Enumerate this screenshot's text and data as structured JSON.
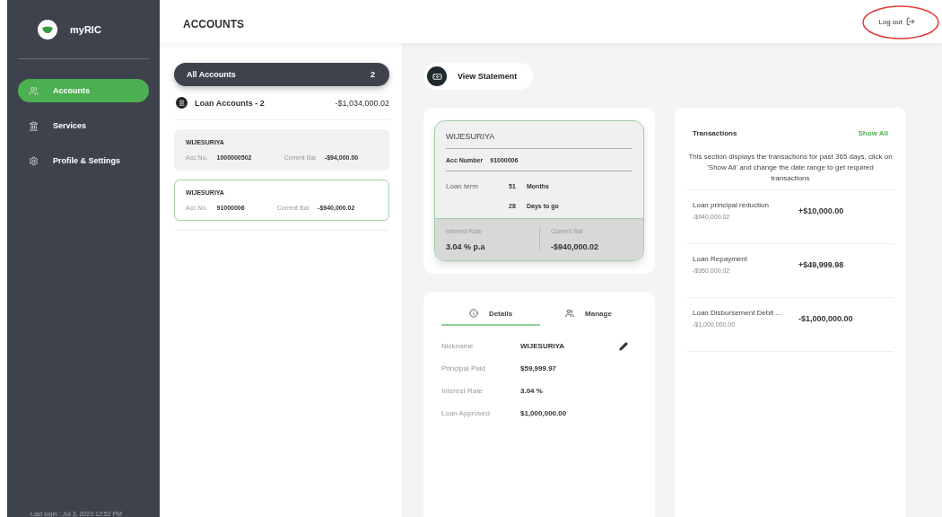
{
  "brand": {
    "name": "myRIC"
  },
  "nav": [
    {
      "label": "Accounts",
      "selected": true
    },
    {
      "label": "Services",
      "selected": false
    },
    {
      "label": "Profile & Settings",
      "selected": false
    }
  ],
  "last_login": "Last login : Jul 3, 2023 12:52 PM",
  "header": {
    "title": "ACCOUNTS",
    "logout": {
      "label": "Log out",
      "circled": true
    }
  },
  "all_accounts": {
    "label": "All Accounts",
    "count": "2"
  },
  "group": {
    "label": "Loan Accounts - 2",
    "total": "-$1,034,000.02"
  },
  "accounts": [
    {
      "name": "WIJESURIYA",
      "acc_label": "Acc No.",
      "acc_no": "1000000502",
      "bal_label": "Current Bal",
      "balance": "-$94,000.00",
      "selected": false
    },
    {
      "name": "WIJESURIYA",
      "acc_label": "Acc No.",
      "acc_no": "91000006",
      "bal_label": "Current Bal",
      "balance": "-$940,000.02",
      "selected": true
    }
  ],
  "view_statement": "View Statement",
  "loan_card": {
    "name": "WIJESURIYA",
    "acc_label": "Acc Number",
    "acc_no": "91000006",
    "term_label": "Loan term",
    "term": [
      {
        "value": "51",
        "unit": "Months"
      },
      {
        "value": "28",
        "unit": "Days to go"
      }
    ],
    "rate_label": "Interest Rate",
    "rate": "3.04 % p.a",
    "bal_label": "Current Bal",
    "balance": "-$940,000.02"
  },
  "detail_tabs": [
    {
      "label": "Details",
      "selected": true
    },
    {
      "label": "Manage",
      "selected": false
    }
  ],
  "details": [
    {
      "label": "Nickname",
      "value": "WIJESURIYA",
      "editable": true
    },
    {
      "label": "Principal Paid",
      "value": "$59,999.97",
      "editable": false
    },
    {
      "label": "Interest Rate",
      "value": "3.04 %",
      "editable": false
    },
    {
      "label": "Loan Approved",
      "value": "$1,000,000.00",
      "editable": false
    }
  ],
  "transactions": {
    "title": "Transactions",
    "show_all": "Show All",
    "note": "This section displays the transactions for past 365 days, click on 'Show All' and change the date range to get required transactions",
    "items": [
      {
        "description": "Loan principal reduction",
        "balance": "-$940,000.02",
        "amount": "+$10,000.00"
      },
      {
        "description": "Loan Repayment",
        "balance": "-$950,000.02",
        "amount": "+$49,999.98"
      },
      {
        "description": "Loan Disbursement Debit ...",
        "balance": "-$1,000,000.00",
        "amount": "-$1,000,000.00"
      }
    ]
  }
}
